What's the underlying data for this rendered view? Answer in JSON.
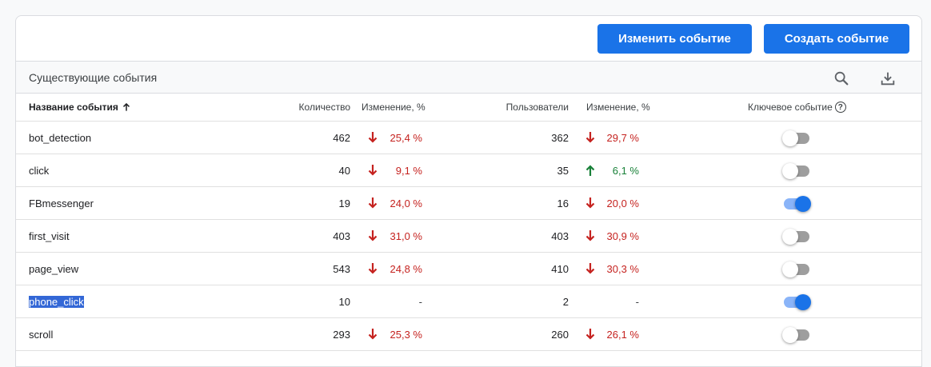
{
  "toolbar": {
    "edit_label": "Изменить событие",
    "create_label": "Создать событие"
  },
  "section": {
    "title": "Существующие события"
  },
  "icons": {
    "search": "search-icon",
    "download": "download-icon"
  },
  "colors": {
    "accent": "#1a73e8",
    "down": "#c5221f",
    "up": "#188038"
  },
  "table": {
    "headers": {
      "name": "Название события",
      "count": "Количество",
      "change_count": "Изменение, %",
      "users": "Пользователи",
      "change_users": "Изменение, %",
      "key_event": "Ключевое событие"
    },
    "sort": {
      "column": "name",
      "direction": "ascending"
    },
    "rows": [
      {
        "name": "bot_detection",
        "count": "462",
        "count_change": "25,4 %",
        "count_trend": "down",
        "users": "362",
        "users_change": "29,7 %",
        "users_trend": "down",
        "key_event": false,
        "selected": false
      },
      {
        "name": "click",
        "count": "40",
        "count_change": "9,1 %",
        "count_trend": "down",
        "users": "35",
        "users_change": "6,1 %",
        "users_trend": "up",
        "key_event": false,
        "selected": false
      },
      {
        "name": "FBmessenger",
        "count": "19",
        "count_change": "24,0 %",
        "count_trend": "down",
        "users": "16",
        "users_change": "20,0 %",
        "users_trend": "down",
        "key_event": true,
        "selected": false
      },
      {
        "name": "first_visit",
        "count": "403",
        "count_change": "31,0 %",
        "count_trend": "down",
        "users": "403",
        "users_change": "30,9 %",
        "users_trend": "down",
        "key_event": false,
        "selected": false
      },
      {
        "name": "page_view",
        "count": "543",
        "count_change": "24,8 %",
        "count_trend": "down",
        "users": "410",
        "users_change": "30,3 %",
        "users_trend": "down",
        "key_event": false,
        "selected": false
      },
      {
        "name": "phone_click",
        "count": "10",
        "count_change": "-",
        "count_trend": "none",
        "users": "2",
        "users_change": "-",
        "users_trend": "none",
        "key_event": true,
        "selected": true
      },
      {
        "name": "scroll",
        "count": "293",
        "count_change": "25,3 %",
        "count_trend": "down",
        "users": "260",
        "users_change": "26,1 %",
        "users_trend": "down",
        "key_event": false,
        "selected": false
      }
    ]
  }
}
